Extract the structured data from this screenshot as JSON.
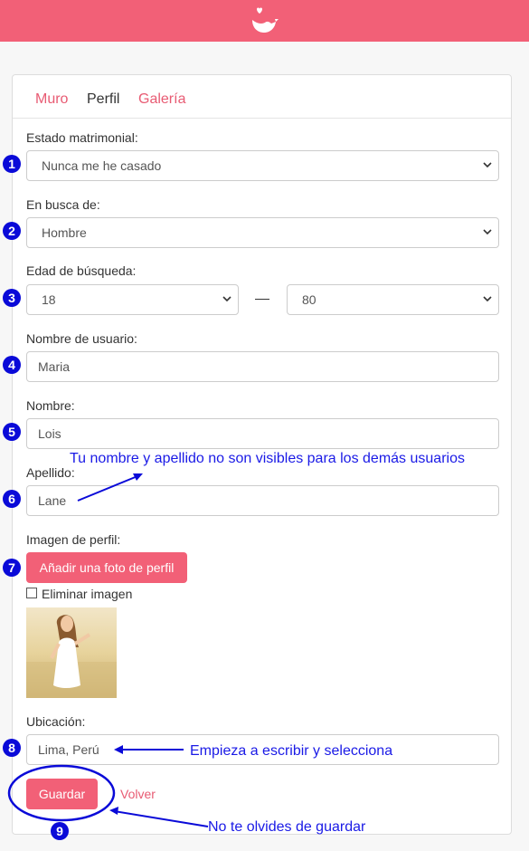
{
  "header": {
    "logo_icon": "bird-heart-icon",
    "brand_color": "#f26077"
  },
  "tabs": [
    {
      "label": "Muro",
      "active": false
    },
    {
      "label": "Perfil",
      "active": true
    },
    {
      "label": "Galería",
      "active": false
    }
  ],
  "form": {
    "marital_status": {
      "label": "Estado matrimonial:",
      "value": "Nunca me he casado"
    },
    "seeking": {
      "label": "En busca de:",
      "value": "Hombre"
    },
    "age_range": {
      "label": "Edad de búsqueda:",
      "min": "18",
      "max": "80",
      "separator": "—"
    },
    "username": {
      "label": "Nombre de usuario:",
      "value": "Maria"
    },
    "first_name": {
      "label": "Nombre:",
      "value": "Lois"
    },
    "last_name": {
      "label": "Apellido:",
      "value": "Lane"
    },
    "profile_image": {
      "label": "Imagen de perfil:",
      "add_button": "Añadir una foto de perfil",
      "remove_label": "Eliminar imagen",
      "remove_checked": false
    },
    "location": {
      "label": "Ubicación:",
      "value": "Lima, Perú"
    },
    "save_button": "Guardar",
    "back_link": "Volver"
  },
  "annotations": {
    "badges": [
      "1",
      "2",
      "3",
      "4",
      "5",
      "6",
      "7",
      "8",
      "9"
    ],
    "name_note": "Tu nombre y apellido no son visibles para los demás usuarios",
    "location_note": "Empieza a escribir y selecciona",
    "save_note": "No te olvides de guardar",
    "color": "#0a0ad8"
  }
}
